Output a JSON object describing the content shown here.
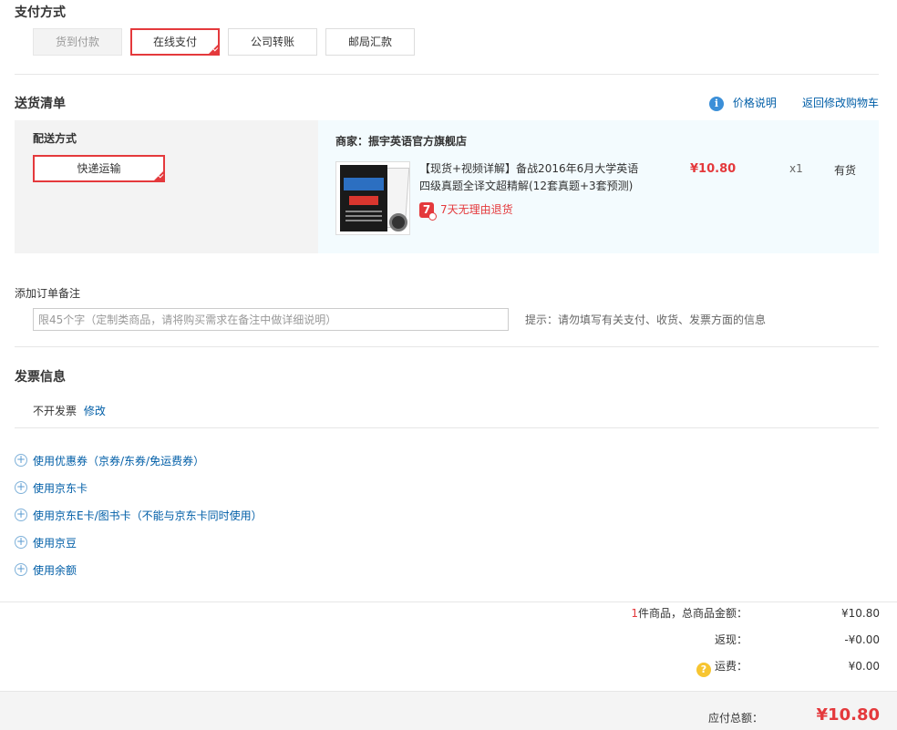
{
  "payment": {
    "title": "支付方式",
    "options": [
      {
        "label": "货到付款",
        "state": "disabled"
      },
      {
        "label": "在线支付",
        "state": "selected"
      },
      {
        "label": "公司转账",
        "state": "normal"
      },
      {
        "label": "邮局汇款",
        "state": "normal"
      }
    ]
  },
  "delivery": {
    "title": "送货清单",
    "price_note": "价格说明",
    "back_to_cart": "返回修改购物车",
    "method_title": "配送方式",
    "method_selected": "快递运输",
    "merchant": "商家：振宇英语官方旗舰店",
    "item": {
      "name_line1": "【现货+视频详解】备战2016年6月大学英语",
      "name_line2": "四级真题全译文超精解(12套真题+3套预测)",
      "price": "¥10.80",
      "qty": "x1",
      "stock": "有货",
      "return_badge": "7",
      "return_policy": "7天无理由退货"
    }
  },
  "remark": {
    "title": "添加订单备注",
    "placeholder": "限45个字（定制类商品，请将购买需求在备注中做详细说明）",
    "value": "",
    "hint": "提示：请勿填写有关支付、收货、发票方面的信息"
  },
  "invoice": {
    "title": "发票信息",
    "value": "不开发票",
    "edit": "修改"
  },
  "extras": [
    "使用优惠券（京券/东券/免运费券）",
    "使用京东卡",
    "使用京东E卡/图书卡（不能与京东卡同时使用）",
    "使用京豆",
    "使用余额"
  ],
  "summary": {
    "count": "1",
    "count_suffix": "件商品，总商品金额：",
    "subtotal": "¥10.80",
    "rebate_label": "返现：",
    "rebate": "-¥0.00",
    "shipping_label": "运费：",
    "shipping": "¥0.00",
    "total_label": "应付总额：",
    "total": "¥10.80"
  },
  "colors": {
    "accent": "#e4393c",
    "link": "#005ea7",
    "orange": "#e4393c"
  },
  "icons": {
    "info": "info-icon",
    "plus": "plus-circle-icon",
    "question": "question-icon",
    "check_corner": "check-corner-icon"
  }
}
